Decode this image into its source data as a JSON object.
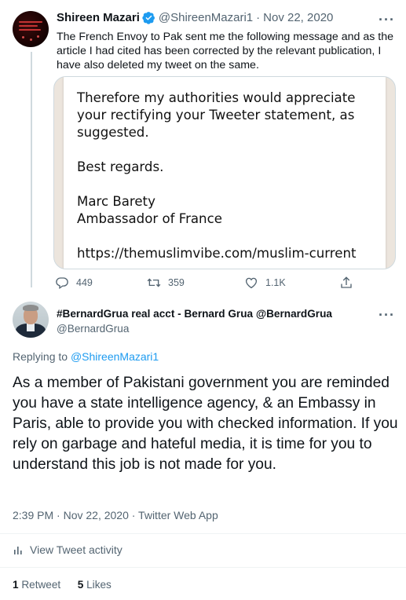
{
  "tweet1": {
    "name": "Shireen Mazari",
    "handle": "@ShireenMazari1",
    "separator": "·",
    "date": "Nov 22, 2020",
    "text": "The French Envoy to Pak sent me the following message and as the article I had cited has been corrected by the relevant publication, I have also deleted my tweet on the same.",
    "image": {
      "p1": "Therefore my authorities would appreciate your rectifying your Tweeter statement, as suggested.",
      "p2": "Best regards.",
      "p3a": "Marc Barety",
      "p3b": "Ambassador of France",
      "link": "https://themuslimvibe.com/muslim-current"
    },
    "actions": {
      "replies": "449",
      "retweets": "359",
      "likes": "1.1K"
    }
  },
  "tweet2": {
    "name_line": "#BernardGrua real acct - Bernard Grua @BernardGrua",
    "handle": "@BernardGrua",
    "replying_prefix": "Replying to ",
    "replying_to": "@ShireenMazari1",
    "text": "As a member of Pakistani government you are reminded you have a state intelligence agency, & an Embassy in Paris, able to provide you with checked information. If you rely on garbage and hateful media, it is time for you to understand this job is not made for you.",
    "meta": "2:39 PM · Nov 22, 2020 · Twitter Web App",
    "activity_label": "View Tweet activity",
    "retweet_count": "1",
    "retweet_label": " Retweet",
    "like_count": "5",
    "like_label": " Likes"
  },
  "icons": {
    "more": "more-icon",
    "verified": "verified-badge-icon",
    "reply": "reply-icon",
    "retweet": "retweet-icon",
    "like": "heart-icon",
    "share": "share-icon",
    "activity": "bar-chart-icon"
  },
  "colors": {
    "accent": "#1d9bf0",
    "secondary_text": "#536471",
    "primary_text": "#0f1419",
    "border": "#cfd9de"
  }
}
